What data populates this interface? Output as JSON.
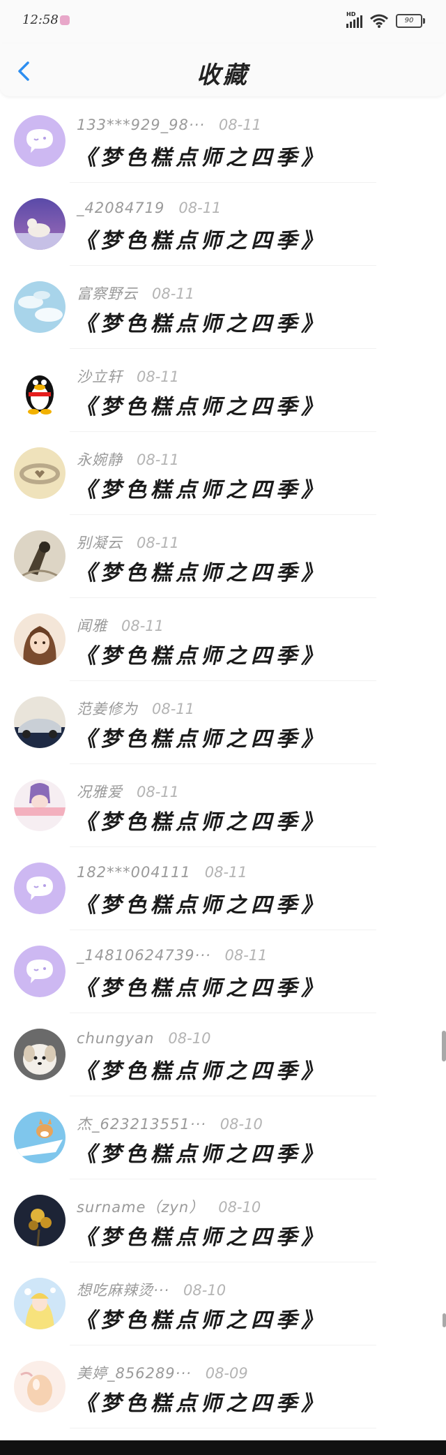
{
  "status_bar": {
    "time": "12:58",
    "network_label": "HD",
    "battery": "90"
  },
  "header": {
    "title": "收藏",
    "back_icon": "chevron-left-icon",
    "accent_color": "#2d8ef0"
  },
  "items": [
    {
      "name": "133***929_98···",
      "date": "08-11",
      "title": "《梦色糕点师之四季》",
      "avatar": "default-chat-avatar"
    },
    {
      "name": "_42084719",
      "date": "08-11",
      "title": "《梦色糕点师之四季》",
      "avatar": "polar-bear-photo"
    },
    {
      "name": "富察野云",
      "date": "08-11",
      "title": "《梦色糕点师之四季》",
      "avatar": "sky-clouds-photo"
    },
    {
      "name": "沙立轩",
      "date": "08-11",
      "title": "《梦色糕点师之四季》",
      "avatar": "qq-penguin"
    },
    {
      "name": "永婉静",
      "date": "08-11",
      "title": "《梦色糕点师之四季》",
      "avatar": "ring-photo"
    },
    {
      "name": "别凝云",
      "date": "08-11",
      "title": "《梦色糕点师之四季》",
      "avatar": "bird-photo"
    },
    {
      "name": "闻雅",
      "date": "08-11",
      "title": "《梦色糕点师之四季》",
      "avatar": "anime-girl"
    },
    {
      "name": "范姜修为",
      "date": "08-11",
      "title": "《梦色糕点师之四季》",
      "avatar": "car-photo"
    },
    {
      "name": "况雅爱",
      "date": "08-11",
      "title": "《梦色糕点师之四季》",
      "avatar": "purple-hair-girl"
    },
    {
      "name": "182***004111",
      "date": "08-11",
      "title": "《梦色糕点师之四季》",
      "avatar": "default-chat-avatar"
    },
    {
      "name": "_14810624739···",
      "date": "08-11",
      "title": "《梦色糕点师之四季》",
      "avatar": "default-chat-avatar"
    },
    {
      "name": "chungyan",
      "date": "08-10",
      "title": "《梦色糕点师之四季》",
      "avatar": "dog-photo"
    },
    {
      "name": "杰_623213551···",
      "date": "08-10",
      "title": "《梦色糕点师之四季》",
      "avatar": "corgi-plane"
    },
    {
      "name": "surname（zyn）",
      "date": "08-10",
      "title": "《梦色糕点师之四季》",
      "avatar": "dark-flowers"
    },
    {
      "name": "想吃麻辣烫···",
      "date": "08-10",
      "title": "《梦色糕点师之四季》",
      "avatar": "fairy-anime"
    },
    {
      "name": "美婷_856289···",
      "date": "08-09",
      "title": "《梦色糕点师之四季》",
      "avatar": "egg-photo"
    }
  ]
}
